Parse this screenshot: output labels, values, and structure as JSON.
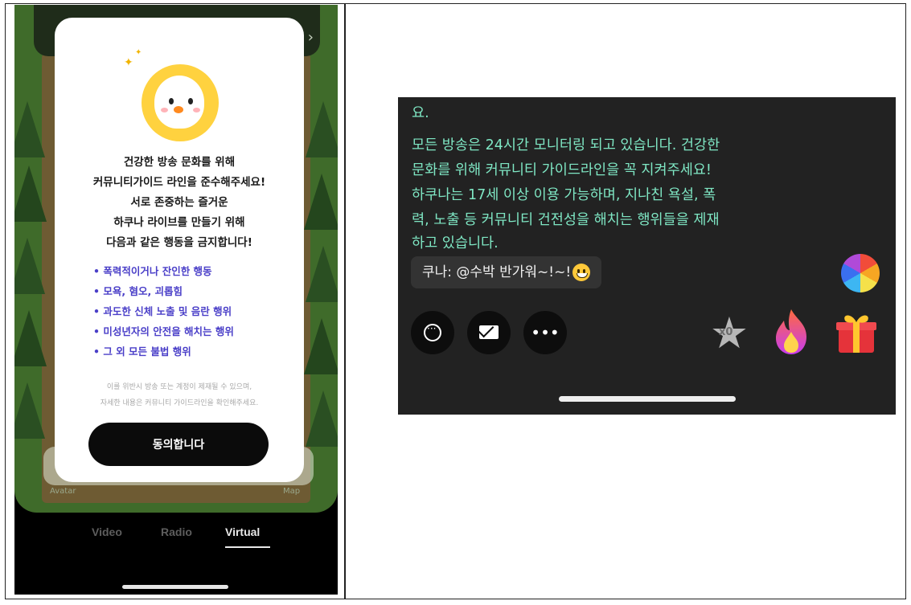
{
  "left_screen": {
    "modal": {
      "lines": [
        "건강한 방송 문화를 위해",
        "커뮤니티가이드 라인을 준수해주세요!",
        "서로 존중하는 즐거운",
        "하쿠나 라이브를 만들기 위해",
        "다음과 같은 행동을 금지합니다!"
      ],
      "rules": [
        "• 폭력적이거나 잔인한 행동",
        "• 모욕, 혐오, 괴롭힘",
        "• 과도한 신체 노출 및 음란 행위",
        "• 미성년자의 안전을 해치는 행위",
        "• 그 외 모든 불법 행위"
      ],
      "fine_print": [
        "이를 위반시 방송 또는 계정이 제재될 수 있으며,",
        "자세한 내용은 커뮤니티 가이드라인을 확인해주세요."
      ],
      "agree_button": "동의합니다"
    },
    "captions": {
      "left": "Avatar",
      "right": "Map"
    },
    "tabs": [
      {
        "label": "Video",
        "active": false
      },
      {
        "label": "Radio",
        "active": false
      },
      {
        "label": "Virtual",
        "active": true
      }
    ]
  },
  "right_screen": {
    "notice_lines": [
      "요.",
      "모든 방송은 24시간 모니터링 되고 있습니다. 건강한",
      "문화를 위해 커뮤니티 가이드라인을 꼭 지켜주세요!",
      "하쿠나는 17세 이상 이용 가능하며, 지나친 욕설, 폭",
      "력, 노출 등 커뮤니티 건전성을 해치는 행위들을 제재",
      "하고 있습니다."
    ],
    "chat_message": "쿠나: @수박 반가워~!~!",
    "star_badge": "x0",
    "colors": {
      "notice_text": "#7fe7c4",
      "chat_bg": "#222222"
    }
  }
}
